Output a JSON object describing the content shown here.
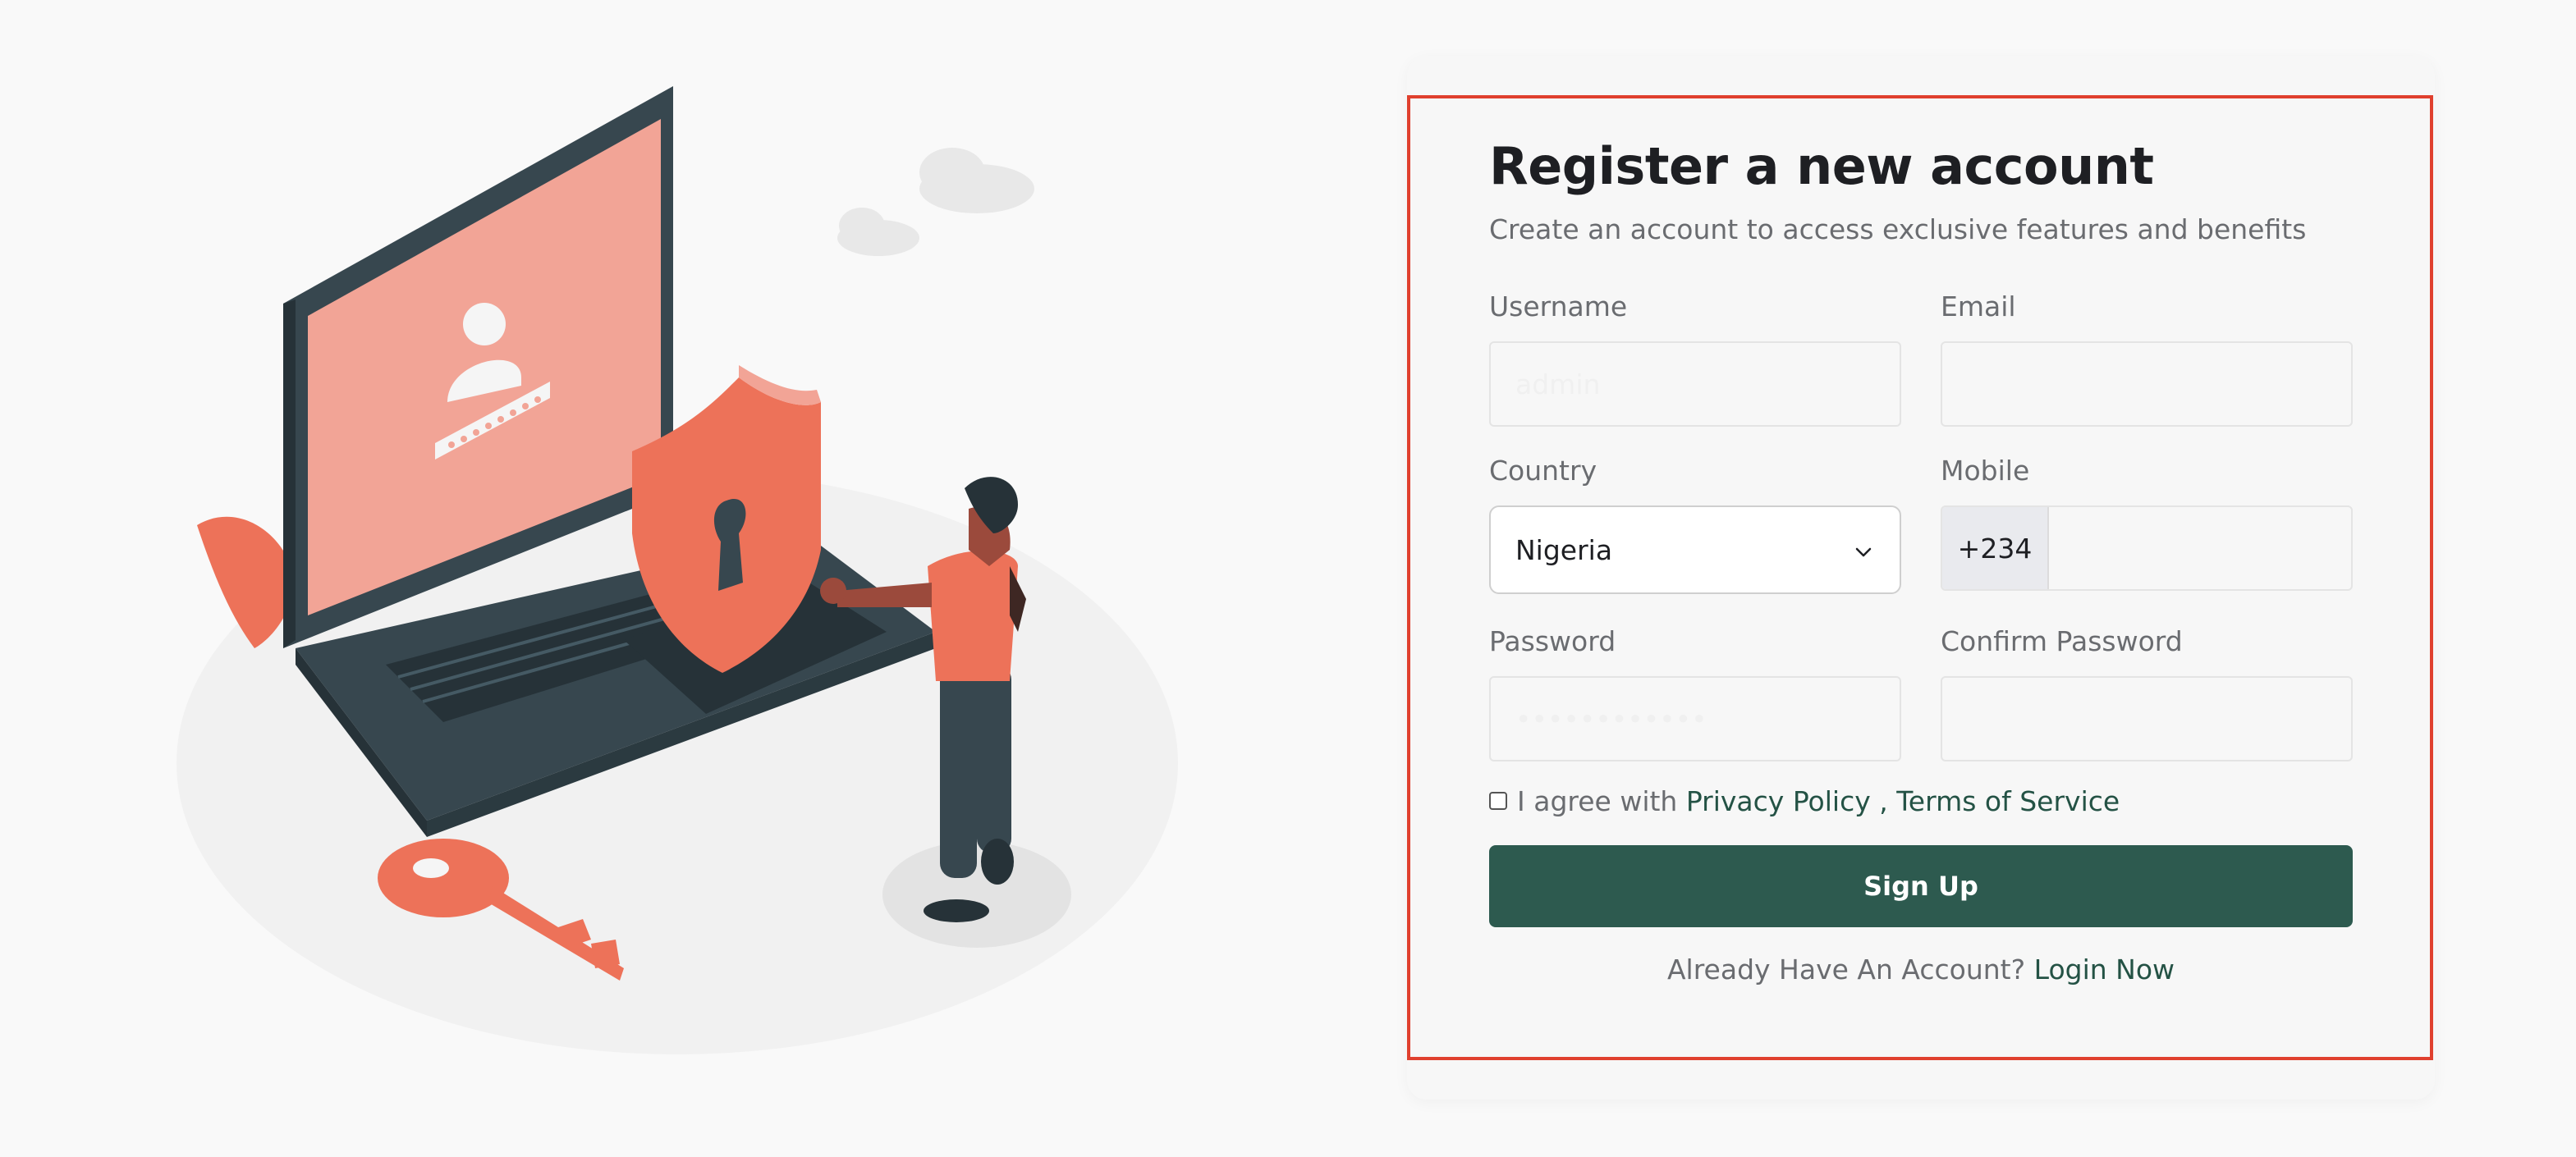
{
  "form": {
    "title": "Register a new account",
    "subtitle": "Create an account to access exclusive features and benefits",
    "username": {
      "label": "Username",
      "value": "admin"
    },
    "email": {
      "label": "Email",
      "value": ""
    },
    "country": {
      "label": "Country",
      "selected": "Nigeria"
    },
    "mobile": {
      "label": "Mobile",
      "prefix": "+234",
      "value": ""
    },
    "password": {
      "label": "Password",
      "value": "••••••••••••"
    },
    "confirm_password": {
      "label": "Confirm Password",
      "value": ""
    },
    "agree": {
      "text": "I agree with",
      "privacy_link": "Privacy Policy",
      "separator": ",",
      "terms_link": "Terms of Service"
    },
    "signup_label": "Sign Up",
    "login_prompt": "Already Have An Account?",
    "login_link": "Login Now"
  },
  "colors": {
    "accent": "#2d5a4f",
    "highlight_border": "#e0402e",
    "illustration_primary": "#ed7259",
    "illustration_dark": "#37474f"
  },
  "icons": {
    "select_chevron": "chevron-down-icon"
  }
}
